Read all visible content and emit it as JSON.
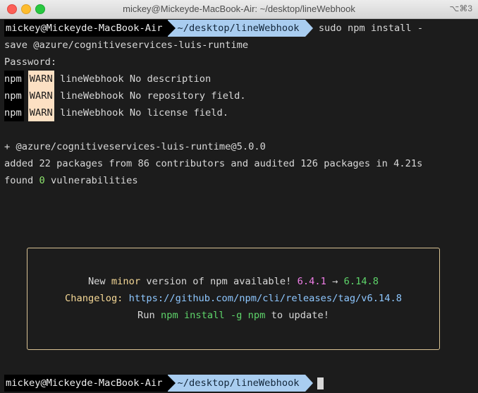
{
  "window": {
    "title": "mickey@Mickeyde-MacBook-Air: ~/desktop/lineWebhook",
    "shortcut": "⌥⌘3"
  },
  "prompt": {
    "user": "mickey@Mickeyde-MacBook-Air",
    "path": "~/desktop/lineWebhook"
  },
  "command": {
    "first": "sudo npm install -",
    "cont": "save @azure/cognitiveservices-luis-runtime"
  },
  "password_prompt": "Password:",
  "warnings": [
    {
      "prefix": "npm",
      "level": "WARN",
      "message": "lineWebhook No description"
    },
    {
      "prefix": "npm",
      "level": "WARN",
      "message": "lineWebhook No repository field."
    },
    {
      "prefix": "npm",
      "level": "WARN",
      "message": "lineWebhook No license field."
    }
  ],
  "install": {
    "package_line": "+ @azure/cognitiveservices-luis-runtime@5.0.0",
    "summary": "added 22 packages from 86 contributors and audited 126 packages in 4.21s",
    "found": "found",
    "vuln_count": "0",
    "vuln_label": "vulnerabilities"
  },
  "notice": {
    "l1_a": "New",
    "l1_b": "minor",
    "l1_c": "version of npm available!",
    "current": "6.4.1",
    "arrow": "→",
    "latest": "6.14.8",
    "changelog_label": "Changelog:",
    "changelog_url": "https://github.com/npm/cli/releases/tag/v6.14.8",
    "run": "Run",
    "cmd": "npm install -g npm",
    "to_update": "to update!"
  },
  "colors": {
    "background": "#1c1c1c",
    "path_segment": "#a9cdf0",
    "warn_badge": "#fce0c3",
    "green": "#8ee46e",
    "pink": "#f07ee8",
    "link": "#8ec7ff",
    "box_border": "#d9c394"
  }
}
